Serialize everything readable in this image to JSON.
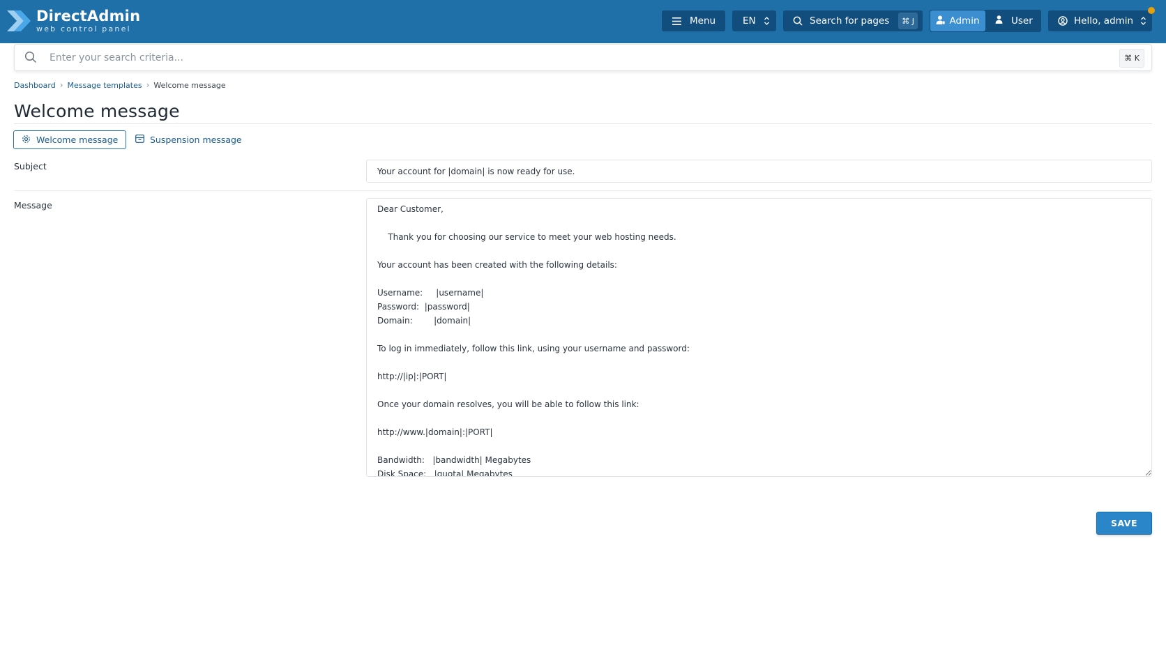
{
  "brand": {
    "title": "DirectAdmin",
    "subtitle": "web control panel"
  },
  "topbar": {
    "menu_label": "Menu",
    "lang_label": "EN",
    "search_label": "Search for pages",
    "search_shortcut": "⌘ J",
    "role_admin": "Admin",
    "role_user": "User",
    "hello_label": "Hello, admin"
  },
  "global_search": {
    "placeholder": "Enter your search criteria...",
    "shortcut": "⌘ K"
  },
  "breadcrumb": [
    "Dashboard",
    "Message templates",
    "Welcome message"
  ],
  "page_title": "Welcome message",
  "tabs": [
    {
      "label": "Welcome message",
      "active": true
    },
    {
      "label": "Suspension message",
      "active": false
    }
  ],
  "form": {
    "subject_label": "Subject",
    "subject_value": "Your account for |domain| is now ready for use.",
    "message_label": "Message",
    "message_value": "Dear Customer,\n\n    Thank you for choosing our service to meet your web hosting needs.\n\nYour account has been created with the following details:\n\nUsername:     |username|\nPassword:  |password|\nDomain:        |domain|\n\nTo log in immediately, follow this link, using your username and password:\n\nhttp://|ip|:|PORT|\n\nOnce your domain resolves, you will be able to follow this link:\n\nhttp://www.|domain|:|PORT|\n\nBandwidth:   |bandwidth| Megabytes\nDisk Space:   |quota| Megabytes",
    "save_label": "SAVE"
  },
  "colors": {
    "header_bg": "#1f6fa8",
    "header_button_bg": "#114e7e",
    "accent": "#2a86c9",
    "notification_dot": "#e4a00d",
    "link": "#1b5d8f"
  }
}
